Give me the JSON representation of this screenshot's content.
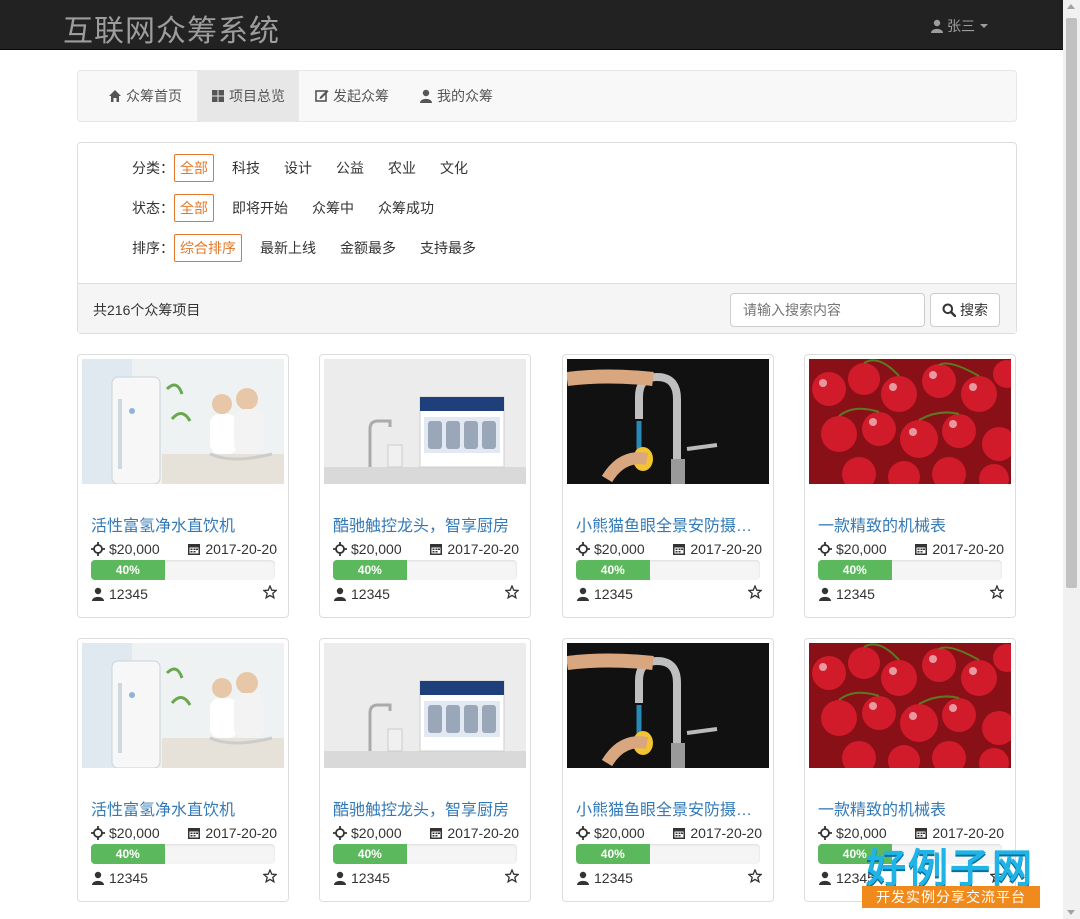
{
  "navbar": {
    "brand": "互联网众筹系统",
    "user": "张三"
  },
  "tabs": [
    {
      "label": "众筹首页",
      "icon": "home-icon"
    },
    {
      "label": "项目总览",
      "icon": "th-large-icon",
      "active": true
    },
    {
      "label": "发起众筹",
      "icon": "edit-icon"
    },
    {
      "label": "我的众筹",
      "icon": "user-icon"
    }
  ],
  "filters": {
    "category": {
      "label": "分类：",
      "options": [
        "全部",
        "科技",
        "设计",
        "公益",
        "农业",
        "文化"
      ],
      "selected": 0
    },
    "status": {
      "label": "状态：",
      "options": [
        "全部",
        "即将开始",
        "众筹中",
        "众筹成功"
      ],
      "selected": 0
    },
    "sort": {
      "label": "排序：",
      "options": [
        "综合排序",
        "最新上线",
        "金额最多",
        "支持最多"
      ],
      "selected": 0
    }
  },
  "summary": {
    "count_text": "共216个众筹项目"
  },
  "search": {
    "placeholder": "请输入搜索内容",
    "button_label": "搜索"
  },
  "projects": [
    {
      "title": "活性富氢净水直饮机",
      "amount": "$20,000",
      "date": "2017-20-20",
      "progress": 40,
      "progress_label": "40%",
      "supporters": "12345",
      "image": "air-purifier-family"
    },
    {
      "title": "酷驰触控龙头，智享厨房",
      "amount": "$20,000",
      "date": "2017-20-20",
      "progress": 40,
      "progress_label": "40%",
      "supporters": "12345",
      "image": "water-filter-faucet"
    },
    {
      "title": "小熊猫鱼眼全景安防摄像头",
      "amount": "$20,000",
      "date": "2017-20-20",
      "progress": 40,
      "progress_label": "40%",
      "supporters": "12345",
      "image": "touch-faucet"
    },
    {
      "title": "一款精致的机械表",
      "amount": "$20,000",
      "date": "2017-20-20",
      "progress": 40,
      "progress_label": "40%",
      "supporters": "12345",
      "image": "cherries"
    },
    {
      "title": "活性富氢净水直饮机",
      "amount": "$20,000",
      "date": "2017-20-20",
      "progress": 40,
      "progress_label": "40%",
      "supporters": "12345",
      "image": "air-purifier-family"
    },
    {
      "title": "酷驰触控龙头，智享厨房",
      "amount": "$20,000",
      "date": "2017-20-20",
      "progress": 40,
      "progress_label": "40%",
      "supporters": "12345",
      "image": "water-filter-faucet"
    },
    {
      "title": "小熊猫鱼眼全景安防摄像头",
      "amount": "$20,000",
      "date": "2017-20-20",
      "progress": 40,
      "progress_label": "40%",
      "supporters": "12345",
      "image": "touch-faucet"
    },
    {
      "title": "一款精致的机械表",
      "amount": "$20,000",
      "date": "2017-20-20",
      "progress": 40,
      "progress_label": "40%",
      "supporters": "12345",
      "image": "cherries"
    }
  ],
  "watermark": {
    "big": "好例子网",
    "small": "开发实例分享交流平台"
  },
  "colors": {
    "navbar": "#222222",
    "accent": "#e4782a",
    "link": "#337ab7",
    "progress": "#5cb85c"
  }
}
